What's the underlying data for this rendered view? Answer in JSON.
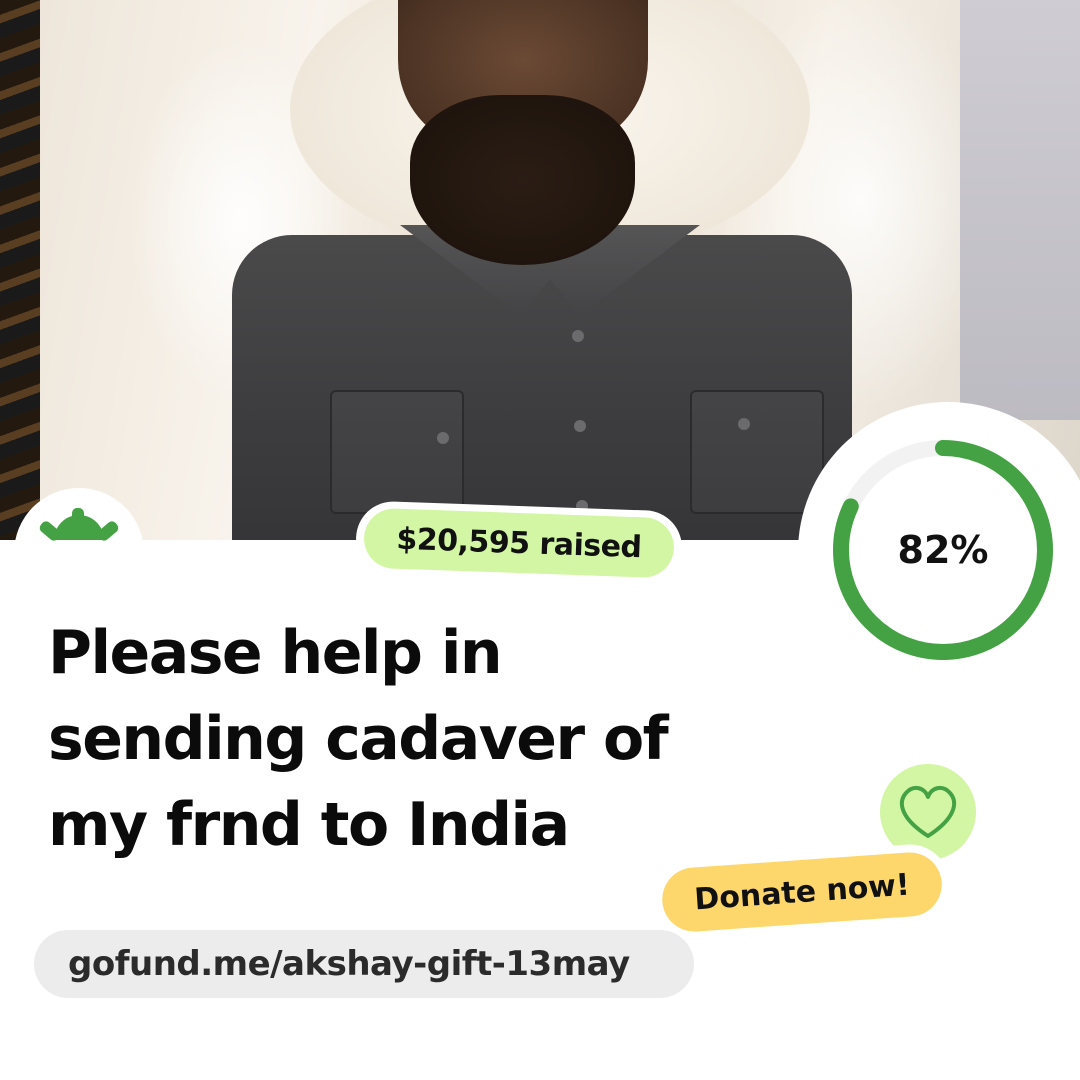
{
  "campaign": {
    "raised_label": "$20,595 raised",
    "progress_label": "82%",
    "progress_fraction": 0.82,
    "title": "Please help in sending cadaver of my frnd to India",
    "donate_label": "Donate now!",
    "url": "gofund.me/akshay-gift-13may"
  },
  "icons": {
    "logo": "sunrise-logo-icon",
    "heart": "heart-icon"
  },
  "colors": {
    "brand_green": "#45a244",
    "badge_green": "#d2f6a3",
    "donate_yellow": "#fdd76b",
    "url_pill_gray": "#ececec",
    "progress_track": "#f2f2f2"
  }
}
